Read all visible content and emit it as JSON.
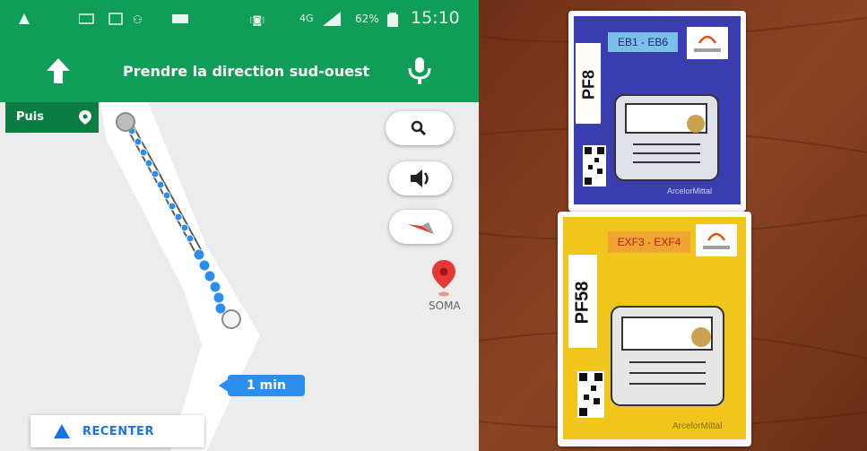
{
  "status_bar": {
    "battery": "62%",
    "network": "4G",
    "time": "15:10"
  },
  "navigation": {
    "instruction": "Prendre la direction sud-ouest",
    "then_label": "Puis"
  },
  "map": {
    "eta_label": "1 min",
    "poi_label": "SOMA",
    "recenter_label": "RECENTER"
  },
  "photo": {
    "card_top": {
      "code": "PF8",
      "zone": "EB1 - EB6",
      "brand": "ArcelorMittal"
    },
    "card_bottom": {
      "code": "PF58",
      "zone": "EXF3 - EXF4",
      "brand": "ArcelorMittal"
    }
  },
  "colors": {
    "nav_green": "#0f9d58",
    "route_blue": "#2a8ef0",
    "card_top_bg": "#3a3db0",
    "card_bottom_bg": "#f0c51c"
  }
}
